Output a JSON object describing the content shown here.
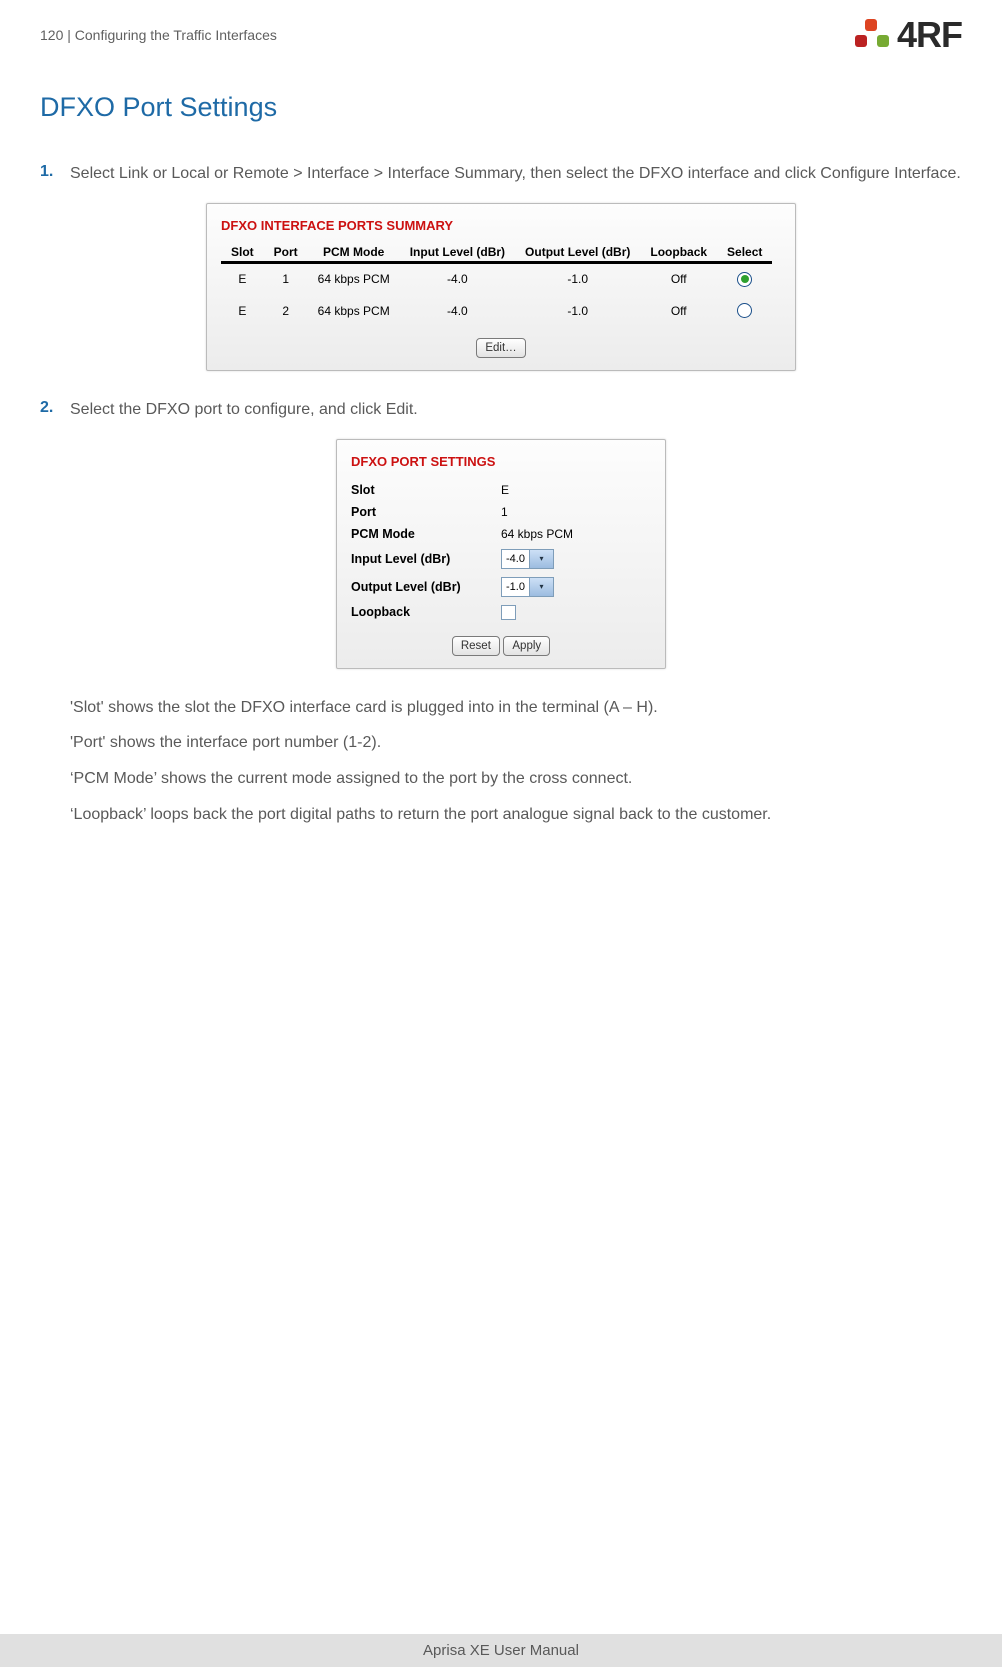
{
  "header": {
    "page_number": "120",
    "separator": "  |  ",
    "breadcrumb": "Configuring the Traffic Interfaces",
    "logo_text": "4RF"
  },
  "title": "DFXO Port Settings",
  "steps": {
    "s1_num": "1.",
    "s1_text": "Select Link or Local or Remote > Interface > Interface Summary, then select the DFXO interface and click Configure Interface.",
    "s2_num": "2.",
    "s2_text": "Select the DFXO port to configure, and click Edit."
  },
  "summary_panel": {
    "title": "DFXO INTERFACE PORTS SUMMARY",
    "headers": {
      "slot": "Slot",
      "port": "Port",
      "pcm_mode": "PCM Mode",
      "input": "Input Level (dBr)",
      "output": "Output Level (dBr)",
      "loopback": "Loopback",
      "select": "Select"
    },
    "rows": [
      {
        "slot": "E",
        "port": "1",
        "pcm_mode": "64 kbps PCM",
        "input": "-4.0",
        "output": "-1.0",
        "loopback": "Off",
        "selected": true
      },
      {
        "slot": "E",
        "port": "2",
        "pcm_mode": "64 kbps PCM",
        "input": "-4.0",
        "output": "-1.0",
        "loopback": "Off",
        "selected": false
      }
    ],
    "edit_button": "Edit…"
  },
  "settings_panel": {
    "title": "DFXO PORT SETTINGS",
    "labels": {
      "slot": "Slot",
      "port": "Port",
      "pcm_mode": "PCM Mode",
      "input": "Input Level (dBr)",
      "output": "Output Level (dBr)",
      "loopback": "Loopback"
    },
    "values": {
      "slot": "E",
      "port": "1",
      "pcm_mode": "64 kbps PCM",
      "input": "-4.0",
      "output": "-1.0"
    },
    "reset_button": "Reset",
    "apply_button": "Apply"
  },
  "descriptions": {
    "slot": "'Slot' shows the slot the DFXO interface card is plugged into in the terminal (A – H).",
    "port": "'Port' shows the interface port number (1-2).",
    "pcm": "‘PCM Mode’ shows the current mode assigned to the port by the cross connect.",
    "loopback": "‘Loopback’ loops back the port digital paths to return the port analogue signal back to the customer."
  },
  "footer": "Aprisa XE User Manual"
}
